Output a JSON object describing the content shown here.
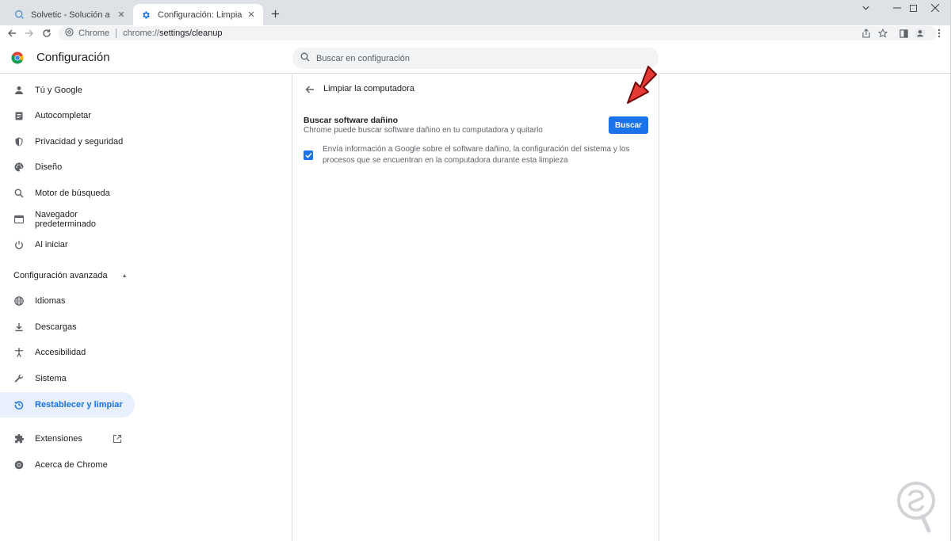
{
  "browser": {
    "tabs": [
      {
        "title": "Solvetic - Solución a los problem",
        "active": false
      },
      {
        "title": "Configuración: Limpiar la compu",
        "active": true
      }
    ],
    "omnibox": {
      "site": "Chrome",
      "url_prefix": "chrome://",
      "url_path": "settings/cleanup"
    },
    "accent": "#1a73e8"
  },
  "header": {
    "title": "Configuración",
    "search_placeholder": "Buscar en configuración"
  },
  "sidebar": {
    "items": [
      {
        "label": "Tú y Google",
        "icon": "person-icon"
      },
      {
        "label": "Autocompletar",
        "icon": "clipboard-icon"
      },
      {
        "label": "Privacidad y seguridad",
        "icon": "shield-icon"
      },
      {
        "label": "Diseño",
        "icon": "palette-icon"
      },
      {
        "label": "Motor de búsqueda",
        "icon": "search-icon"
      },
      {
        "label": "Navegador predeterminado",
        "icon": "browser-icon"
      },
      {
        "label": "Al iniciar",
        "icon": "power-icon"
      }
    ],
    "advanced_section": "Configuración avanzada",
    "advanced_items": [
      {
        "label": "Idiomas",
        "icon": "globe-icon"
      },
      {
        "label": "Descargas",
        "icon": "download-icon"
      },
      {
        "label": "Accesibilidad",
        "icon": "accessibility-icon"
      },
      {
        "label": "Sistema",
        "icon": "wrench-icon"
      },
      {
        "label": "Restablecer y limpiar",
        "icon": "restore-icon",
        "selected": true
      }
    ],
    "extensions": "Extensiones",
    "about": "Acerca de Chrome"
  },
  "main": {
    "subpage_title": "Limpiar la computadora",
    "scan_title": "Buscar software dañino",
    "scan_description": "Chrome puede buscar software dañino en tu computadora y quitarlo",
    "scan_button": "Buscar",
    "report_checkbox_checked": true,
    "report_label": "Envía información a Google sobre el software dañino, la configuración del sistema y los procesos que se encuentran en la computadora durante esta limpieza"
  }
}
